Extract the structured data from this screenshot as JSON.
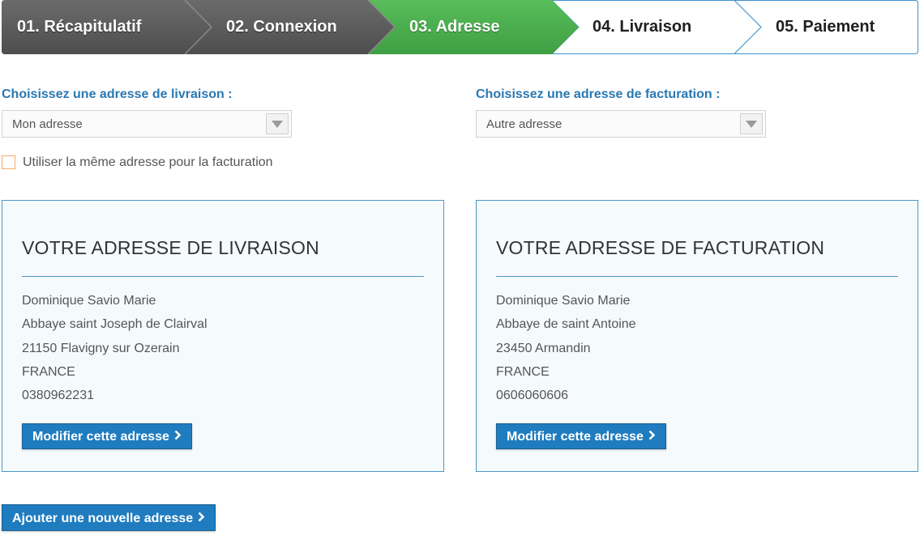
{
  "steps": [
    {
      "label": "01. Récapitulatif",
      "state": "done"
    },
    {
      "label": "02. Connexion",
      "state": "done"
    },
    {
      "label": "03. Adresse",
      "state": "active"
    },
    {
      "label": "04. Livraison",
      "state": "todo"
    },
    {
      "label": "05. Paiement",
      "state": "todo"
    }
  ],
  "delivery_chooser": {
    "title": "Choisissez une adresse de livraison :",
    "selected": "Mon adresse"
  },
  "billing_chooser": {
    "title": "Choisissez une adresse de facturation :",
    "selected": "Autre adresse"
  },
  "same_address_checkbox": {
    "label": "Utiliser la même adresse pour la facturation",
    "checked": false
  },
  "delivery_card": {
    "title": "VOTRE ADRESSE DE LIVRAISON",
    "lines": [
      "Dominique Savio Marie",
      "Abbaye saint Joseph de Clairval",
      "21150 Flavigny sur Ozerain",
      "FRANCE",
      "0380962231"
    ],
    "button": "Modifier cette adresse"
  },
  "billing_card": {
    "title": "VOTRE ADRESSE DE FACTURATION",
    "lines": [
      "Dominique Savio Marie",
      "Abbaye de saint Antoine",
      "23450 Armandin",
      "FRANCE",
      "0606060606"
    ],
    "button": "Modifier cette adresse"
  },
  "add_address_button": "Ajouter une nouvelle adresse",
  "colors": {
    "done_step": "#5a5a5a",
    "active_step": "#4aae4e",
    "todo_border": "#3b93cf",
    "accent_blue": "#1f7cbf",
    "title_blue": "#2a78b1",
    "checkbox_orange": "#f0ad6a"
  },
  "icons": {
    "dropdown": "triangle-down-icon",
    "button_chevron": "chevron-right-icon"
  }
}
